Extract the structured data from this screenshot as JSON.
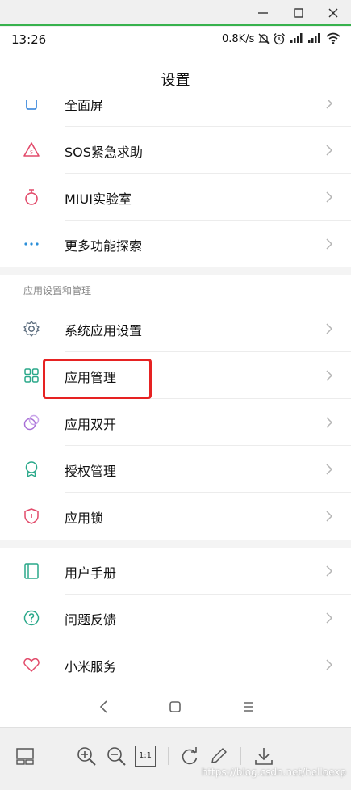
{
  "status": {
    "time": "13:26",
    "speed": "0.8K/s"
  },
  "header": {
    "title": "设置"
  },
  "items_top": [
    {
      "label": "全面屏"
    },
    {
      "label": "SOS紧急求助"
    },
    {
      "label": "MIUI实验室"
    },
    {
      "label": "更多功能探索"
    }
  ],
  "section": {
    "title": "应用设置和管理"
  },
  "items_apps": [
    {
      "label": "系统应用设置"
    },
    {
      "label": "应用管理"
    },
    {
      "label": "应用双开"
    },
    {
      "label": "授权管理"
    },
    {
      "label": "应用锁"
    }
  ],
  "items_bottom": [
    {
      "label": "用户手册"
    },
    {
      "label": "问题反馈"
    },
    {
      "label": "小米服务"
    }
  ],
  "toolbar": {
    "actual_size_label": "1:1"
  },
  "watermark": "https://blog.csdn.net/helloexp",
  "colors": {
    "highlight": "#e62222",
    "accent_green": "#37b24d"
  }
}
